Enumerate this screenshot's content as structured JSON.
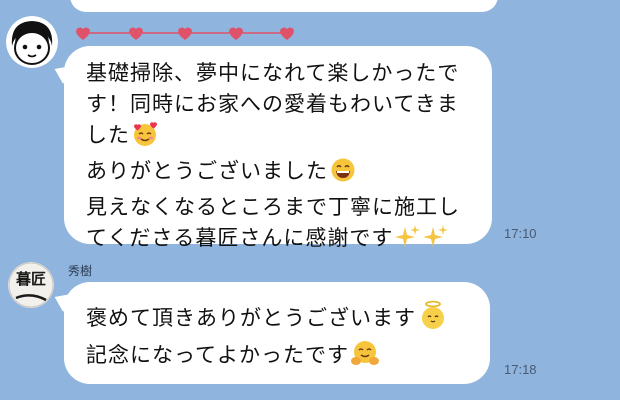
{
  "messages": [
    {
      "lines": [
        "基礎掃除、夢中になれて楽しかったで",
        "す！同時にお家への愛着もわいてきま",
        "した",
        "ありがとうございました",
        "見えなくなるところまで丁寧に施工し",
        "てくださる暮匠さんに感謝です"
      ],
      "time": "17:10"
    },
    {
      "sender": "秀樹",
      "avatar_text": "暮匠",
      "lines": [
        "褒めて頂きありがとうございます",
        "記念になってよかったです"
      ],
      "time": "17:18"
    }
  ],
  "colors": {
    "background": "#8fb4dd",
    "heart": "#e0526a",
    "bubble": "#ffffff"
  },
  "icons": [
    "woman-avatar-icon",
    "smiling-hearts-emoji",
    "grinning-emoji",
    "sparkles-emoji",
    "halo-chick-emoji",
    "hugging-emoji"
  ]
}
